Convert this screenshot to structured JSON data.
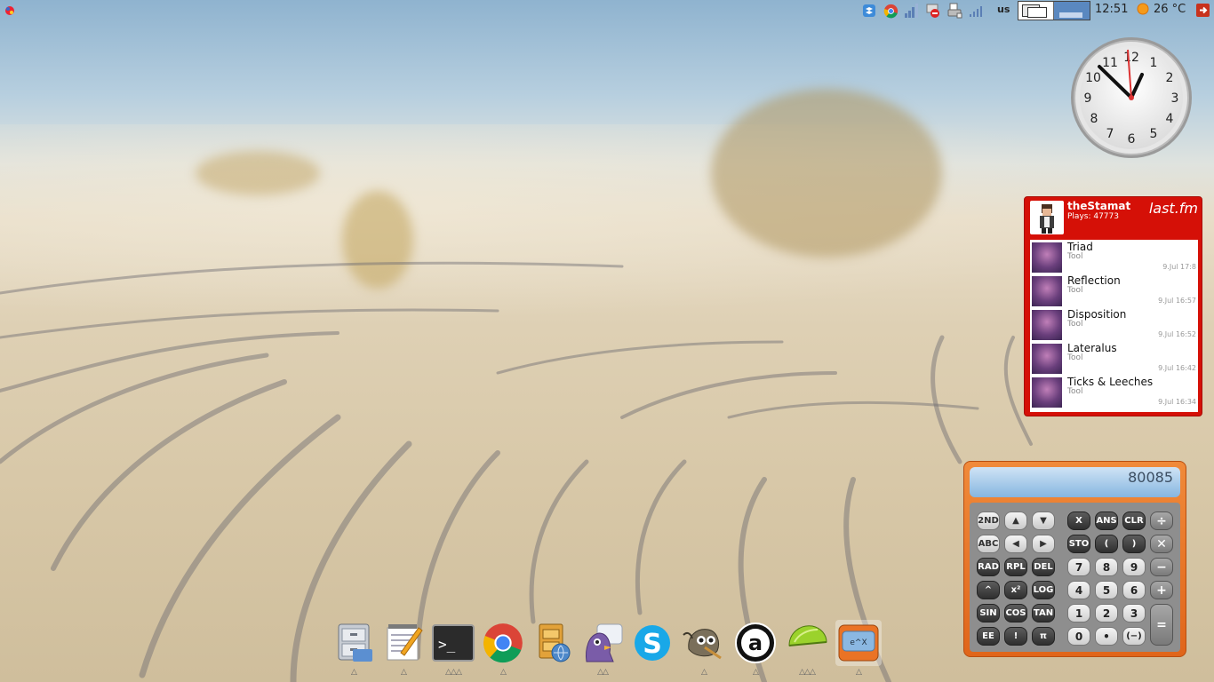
{
  "top_panel": {
    "keyboard_layout": "us",
    "time": "12:51",
    "temperature": "26 °C",
    "tray_icons": [
      "dropbox-icon",
      "chrome-icon",
      "network-signal-icon",
      "block-icon",
      "printer-icon",
      "wifi-icon"
    ]
  },
  "lastfm": {
    "username": "theStamat",
    "plays": "Plays: 47773",
    "logo": "last.fm",
    "tracks": [
      {
        "title": "Triad",
        "artist": "Tool",
        "date": "9.Jul 17:8"
      },
      {
        "title": "Reflection",
        "artist": "Tool",
        "date": "9.Jul 16:57"
      },
      {
        "title": "Disposition",
        "artist": "Tool",
        "date": "9.Jul 16:52"
      },
      {
        "title": "Lateralus",
        "artist": "Tool",
        "date": "9.Jul 16:42"
      },
      {
        "title": "Ticks & Leeches",
        "artist": "Tool",
        "date": "9.Jul 16:34"
      }
    ]
  },
  "calculator": {
    "display": "80085",
    "keys": {
      "k2nd": "2ND",
      "up": "▲",
      "down": "▼",
      "abc": "ABC",
      "left": "◀",
      "right": "▶",
      "rad": "RAD",
      "rpl": "RPL",
      "del": "DEL",
      "pow": "^",
      "sq": "x²",
      "log": "LOG",
      "sin": "SIN",
      "cos": "COS",
      "tan": "TAN",
      "ee": "EE",
      "fact": "!",
      "pi": "π",
      "x": "X",
      "ans": "ANS",
      "clr": "CLR",
      "div": "÷",
      "sto": "STO",
      "lp": "(",
      "rp": ")",
      "mul": "✕",
      "n7": "7",
      "n8": "8",
      "n9": "9",
      "sub": "−",
      "n4": "4",
      "n5": "5",
      "n6": "6",
      "add": "+",
      "n1": "1",
      "n2": "2",
      "n3": "3",
      "eq": "=",
      "n0": "0",
      "dot": "•",
      "neg": "(−)"
    }
  },
  "dock": {
    "items": [
      {
        "name": "file-manager",
        "icon": "file-cabinet-icon"
      },
      {
        "name": "text-editor",
        "icon": "text-editor-icon"
      },
      {
        "name": "terminal",
        "icon": "terminal-icon"
      },
      {
        "name": "chrome",
        "icon": "chrome-icon"
      },
      {
        "name": "filezilla",
        "icon": "filezilla-icon"
      },
      {
        "name": "pidgin",
        "icon": "pidgin-icon"
      },
      {
        "name": "skype",
        "icon": "skype-icon"
      },
      {
        "name": "gimp",
        "icon": "gimp-icon"
      },
      {
        "name": "amarok",
        "icon": "amarok-icon"
      },
      {
        "name": "limewire",
        "icon": "limewire-icon"
      },
      {
        "name": "calculator",
        "icon": "calculator-icon"
      }
    ],
    "terminal_prompt": ">_",
    "calculator_label": "e^X"
  }
}
